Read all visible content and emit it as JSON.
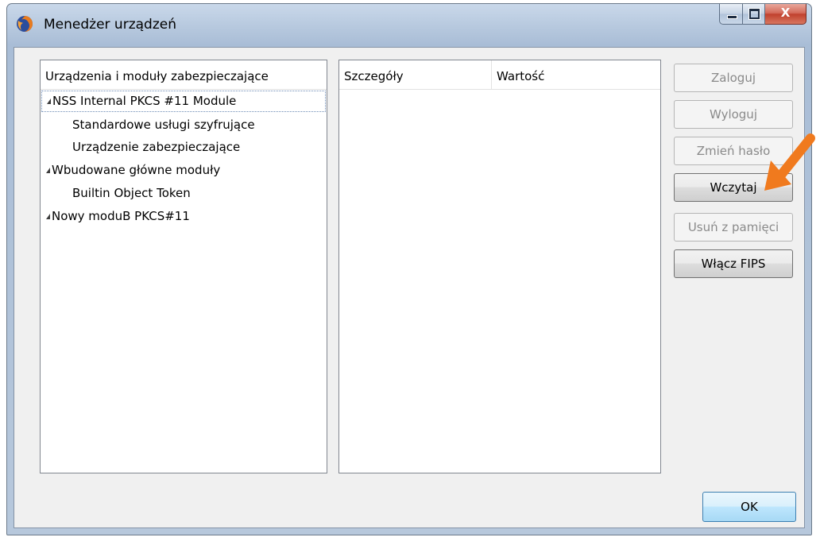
{
  "window": {
    "title": "Menedżer urządzeń",
    "minimize_icon": "minimize-icon",
    "maximize_icon": "maximize-icon",
    "close_glyph": "X"
  },
  "tree": {
    "header": "Urządzenia i moduły zabezpieczające",
    "items": [
      {
        "label": "NSS Internal PKCS #11 Module",
        "level": 0,
        "expanded": true,
        "selected": true
      },
      {
        "label": "Standardowe usługi szyfrujące",
        "level": 1
      },
      {
        "label": "Urządzenie zabezpieczające",
        "level": 1
      },
      {
        "label": "Wbudowane główne moduły",
        "level": 0,
        "expanded": true
      },
      {
        "label": "Builtin Object Token",
        "level": 1
      },
      {
        "label": "Nowy moduB PKCS#11",
        "level": 0,
        "expanded": true
      }
    ]
  },
  "details": {
    "col_details": "Szczegóły",
    "col_value": "Wartość"
  },
  "buttons": {
    "login": "Zaloguj",
    "logout": "Wyloguj",
    "change_password": "Zmień hasło",
    "load": "Wczytaj",
    "unload": "Usuń z pamięci",
    "enable_fips": "Włącz FIPS",
    "ok": "OK"
  },
  "colors": {
    "annotation_arrow": "#f07a1e"
  }
}
